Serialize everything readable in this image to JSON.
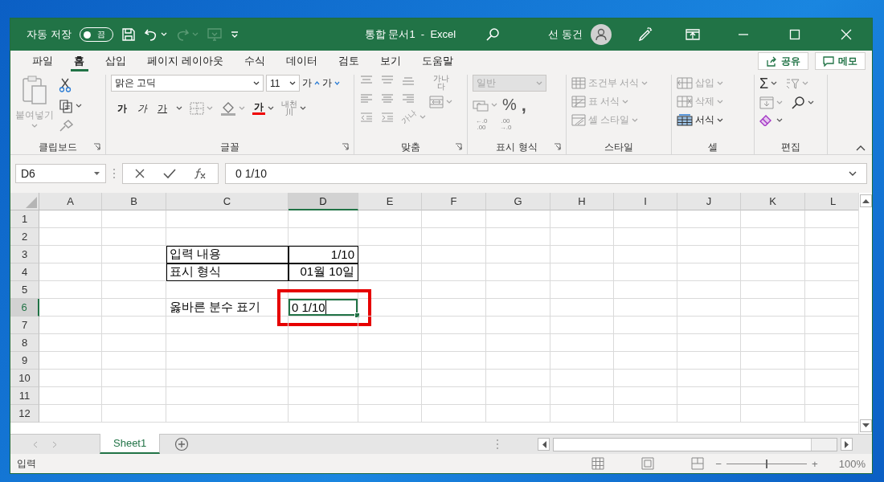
{
  "title_bar": {
    "autosave_label": "자동 저장",
    "autosave": {
      "on": false,
      "label": "끔"
    },
    "redo_disabled": true,
    "document_title": "통합 문서1  -  Excel",
    "user_name": "선 동건"
  },
  "ribbon_tabs": [
    {
      "label": "파일",
      "selected": false
    },
    {
      "label": "홈",
      "selected": true
    },
    {
      "label": "삽입",
      "selected": false
    },
    {
      "label": "페이지 레이아웃",
      "selected": false
    },
    {
      "label": "수식",
      "selected": false
    },
    {
      "label": "데이터",
      "selected": false
    },
    {
      "label": "검토",
      "selected": false
    },
    {
      "label": "보기",
      "selected": false
    },
    {
      "label": "도움말",
      "selected": false
    }
  ],
  "share_button": "공유",
  "comments_button": "메모",
  "clipboard": {
    "paste": {
      "label": "붙여넣기",
      "disabled": true
    },
    "group_label": "클립보드"
  },
  "font": {
    "name": "맑은 고딕",
    "size": "11",
    "grow": "가",
    "shrink": "가",
    "bold": "가",
    "italic": "가",
    "underline": "가",
    "font_color_button": "가",
    "phonetic": [
      "내천",
      "川"
    ],
    "group_label": "글꼴"
  },
  "alignment": {
    "wrap_glyph": [
      "가나",
      "다"
    ],
    "orientation_glyph": "가나",
    "group_label": "맞춤"
  },
  "number": {
    "format": {
      "value": "일반",
      "disabled": true
    },
    "percent": "%",
    "comma": ",",
    "increase_decimal": [
      "←.0",
      ".00"
    ],
    "decrease_decimal": [
      ".00",
      "→.0"
    ],
    "group_label": "표시 형식"
  },
  "styles": {
    "items": [
      {
        "label": "조건부 서식",
        "disabled": true
      },
      {
        "label": "표 서식",
        "disabled": true
      },
      {
        "label": "셀 스타일",
        "disabled": true
      }
    ],
    "group_label": "스타일"
  },
  "cells": {
    "items": [
      {
        "label": "삽입",
        "disabled": true
      },
      {
        "label": "삭제",
        "disabled": true
      },
      {
        "label": "서식",
        "disabled": false
      }
    ],
    "group_label": "셀"
  },
  "editing": {
    "autosum": "Σ",
    "group_label": "편집"
  },
  "formula_bar": {
    "name_box": "D6",
    "formula": "0 1/10"
  },
  "sheet": {
    "columns": [
      {
        "label": "A",
        "selected": false
      },
      {
        "label": "B",
        "selected": false
      },
      {
        "label": "C",
        "selected": false
      },
      {
        "label": "D",
        "selected": true
      },
      {
        "label": "E",
        "selected": false
      },
      {
        "label": "F",
        "selected": false
      },
      {
        "label": "G",
        "selected": false
      },
      {
        "label": "H",
        "selected": false
      },
      {
        "label": "I",
        "selected": false
      },
      {
        "label": "J",
        "selected": false
      },
      {
        "label": "K",
        "selected": false
      },
      {
        "label": "L",
        "selected": false
      }
    ],
    "rows": [
      {
        "number": "1",
        "selected": false
      },
      {
        "number": "2",
        "selected": false
      },
      {
        "number": "3",
        "selected": false,
        "cells": [
          null,
          null,
          {
            "text": "입력 내용",
            "right_aligned": false,
            "bordered": true
          },
          {
            "text": "1/10",
            "right_aligned": true,
            "bordered": true
          }
        ]
      },
      {
        "number": "4",
        "selected": false,
        "cells": [
          null,
          null,
          {
            "text": "표시 형식",
            "right_aligned": false,
            "bordered": true
          },
          {
            "text": "01월 10일",
            "right_aligned": true,
            "bordered": true
          }
        ]
      },
      {
        "number": "5",
        "selected": false
      },
      {
        "number": "6",
        "selected": true,
        "cells": [
          null,
          null,
          {
            "text": "옳바른 분수 표기",
            "right_aligned": false,
            "bordered": false
          },
          {
            "text": "0 1/10",
            "right_aligned": false,
            "bordered": false,
            "editing": true,
            "highlighted": true
          }
        ]
      },
      {
        "number": "7",
        "selected": false
      },
      {
        "number": "8",
        "selected": false
      },
      {
        "number": "9",
        "selected": false
      },
      {
        "number": "10",
        "selected": false
      },
      {
        "number": "11",
        "selected": false
      },
      {
        "number": "12",
        "selected": false
      }
    ]
  },
  "sheet_tabs": [
    {
      "label": "Sheet1",
      "selected": true
    }
  ],
  "status_bar": {
    "mode": "입력",
    "zoom_out": "−",
    "zoom_in": "+",
    "zoom_slider": {
      "level": 0.5
    },
    "zoom": "100%"
  }
}
